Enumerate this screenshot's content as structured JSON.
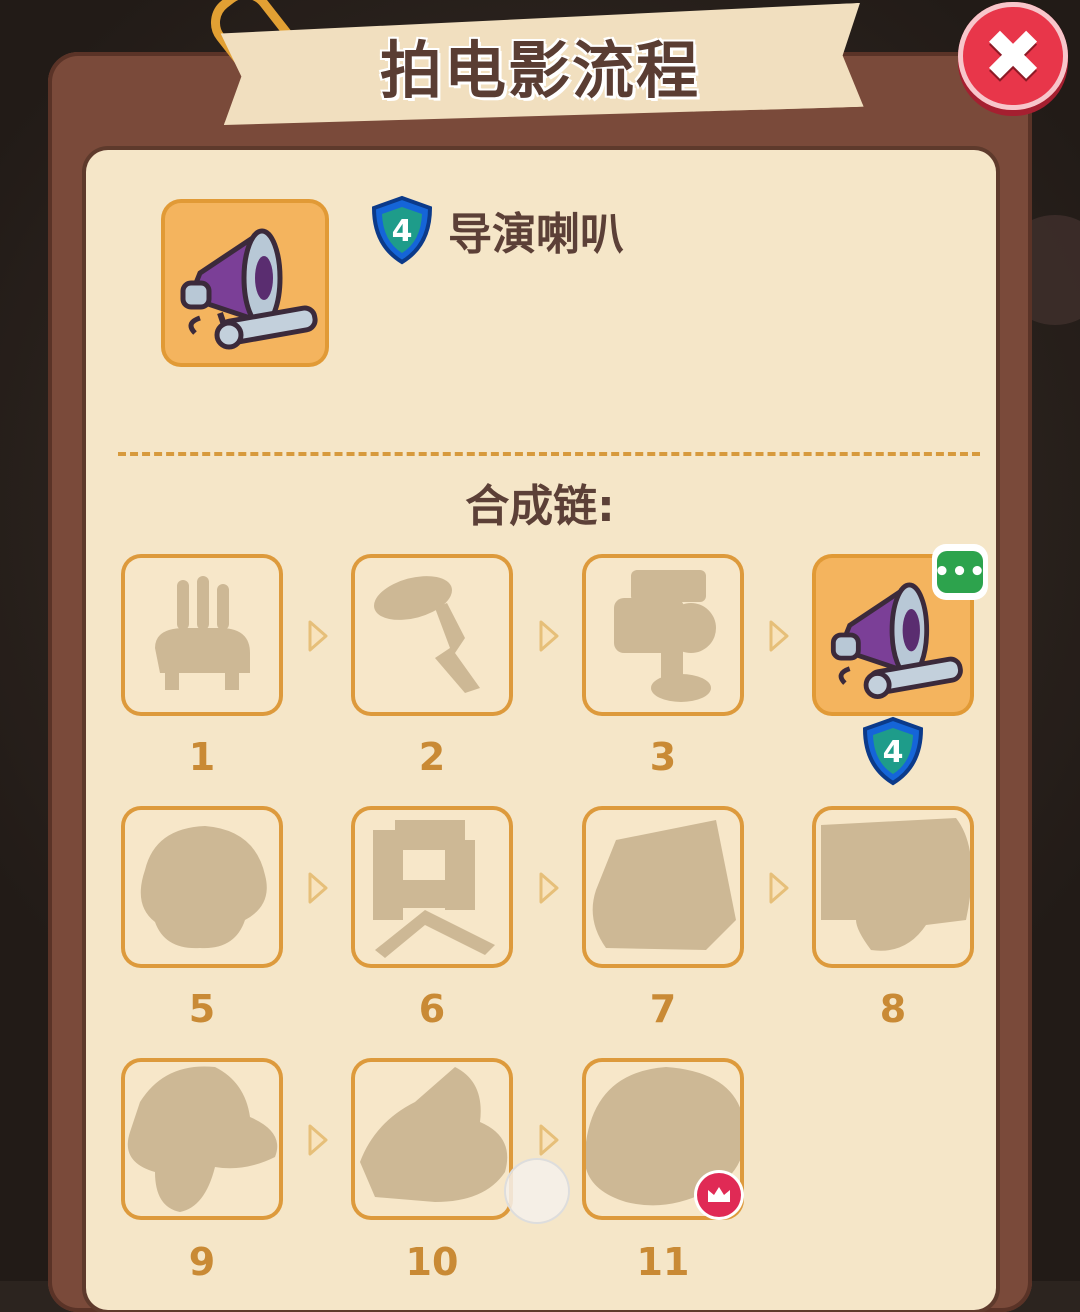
{
  "dialog": {
    "title": "拍电影流程",
    "close_label": "✖"
  },
  "item": {
    "name": "导演喇叭",
    "level": "4",
    "icon": "megaphone-icon"
  },
  "chain": {
    "title": "合成链:",
    "steps": [
      {
        "label": "1",
        "state": "locked",
        "icon": "incense-burner-silhouette"
      },
      {
        "label": "2",
        "state": "locked",
        "icon": "microphone-boom-silhouette"
      },
      {
        "label": "3",
        "state": "locked",
        "icon": "camera-silhouette"
      },
      {
        "label": "4",
        "state": "current",
        "icon": "megaphone-icon",
        "level": "4"
      },
      {
        "label": "5",
        "state": "locked",
        "icon": "reel-silhouette"
      },
      {
        "label": "6",
        "state": "locked",
        "icon": "chair-silhouette"
      },
      {
        "label": "7",
        "state": "locked",
        "icon": "clapperboard-silhouette"
      },
      {
        "label": "8",
        "state": "locked",
        "icon": "projector-silhouette"
      },
      {
        "label": "9",
        "state": "locked",
        "icon": "hat-silhouette"
      },
      {
        "label": "10",
        "state": "locked",
        "icon": "film-camera-silhouette"
      },
      {
        "label": "11",
        "state": "locked",
        "icon": "trophy-silhouette",
        "badge": "crown-icon"
      }
    ]
  },
  "colors": {
    "frame": "#7a4a3a",
    "panel": "#f5e6c8",
    "accent": "#e19a36",
    "close": "#e8364a",
    "shield": "#1565d8"
  }
}
